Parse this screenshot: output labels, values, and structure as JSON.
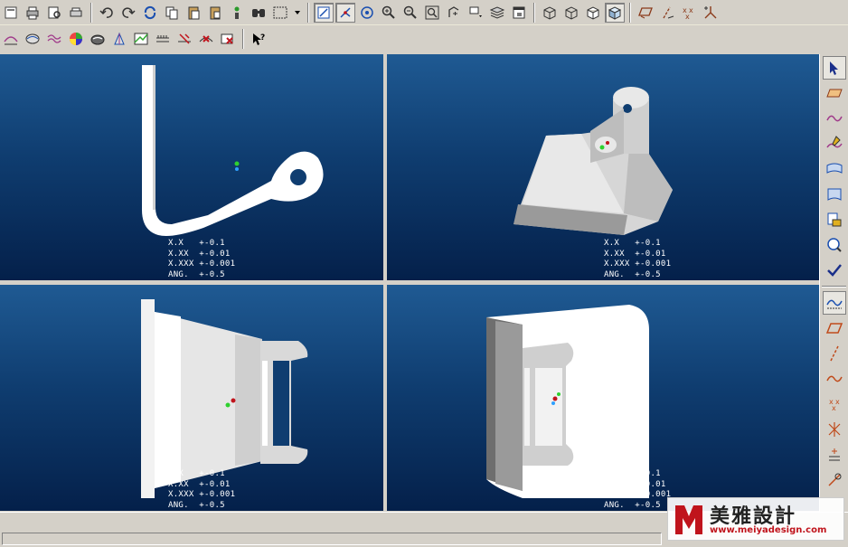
{
  "toolbar_top": {
    "groups": [
      [
        "file-new-icon",
        "print-icon",
        "print-preview-icon",
        "print-setup-icon"
      ],
      [
        "undo-icon",
        "redo-icon",
        "regenerate-icon",
        "copy-icon",
        "paste-icon",
        "paste-special-icon",
        "model-tree-icon",
        "find-icon",
        "select-box-icon",
        "dropdown-arrow-icon"
      ],
      [
        "repaint-icon",
        "spin-center-icon",
        "orient-icon",
        "zoom-in-icon",
        "zoom-out-icon",
        "fit-icon",
        "view-saved-icon",
        "view-list-icon",
        "layers-icon",
        "window-icon"
      ],
      [
        "wireframe-icon",
        "hidden-line-icon",
        "no-hidden-icon",
        "shading-icon"
      ],
      [
        "datum-planes-icon",
        "datum-axes-icon",
        "datum-points-icon",
        "coord-sys-icon"
      ]
    ]
  },
  "toolbar_second": {
    "items": [
      "surface-analysis-icon",
      "curvature-icon",
      "section-icon",
      "shade-analysis-icon",
      "reflection-icon",
      "draft-icon",
      "slope-icon",
      "offset-icon",
      "dihedral-icon",
      "deviation-icon",
      "whats-this-icon"
    ]
  },
  "right_toolbar": {
    "items": [
      "select-arrow-icon",
      "plane-icon",
      "curve-icon",
      "sketch-icon",
      "surface-icon",
      "boundary-surface-icon",
      "blend-icon",
      "query-icon",
      "checkmark-icon",
      "datum-curve-icon",
      "datum-plane-icon",
      "datum-axis-icon",
      "datum-curve2-icon",
      "datum-point-icon",
      "datum-point-field-icon",
      "coord-icon",
      "analysis-icon"
    ]
  },
  "viewports": {
    "top_left": {
      "tolerance": [
        "X.X   +-0.1",
        "X.XX  +-0.01",
        "X.XXX +-0.001",
        "ANG.  +-0.5"
      ]
    },
    "top_right": {
      "tolerance": [
        "X.X   +-0.1",
        "X.XX  +-0.01",
        "X.XXX +-0.001",
        "ANG.  +-0.5"
      ]
    },
    "bottom_left": {
      "tolerance": [
        "X.X   +-0.1",
        "X.XX  +-0.01",
        "X.XXX +-0.001",
        "ANG.  +-0.5"
      ]
    },
    "bottom_right": {
      "tolerance": [
        "X.X   +-0.1",
        "X.XX  +-0.01",
        "X.XXX +-0.001",
        "ANG.  +-0.5"
      ]
    }
  },
  "watermark": {
    "name": "美雅設計",
    "url": "www.meiyadesign.com"
  },
  "colors": {
    "viewport_top": "#1f5a93",
    "viewport_bottom": "#04204a",
    "chrome": "#d4d0c8",
    "accent_red": "#c0141c"
  }
}
